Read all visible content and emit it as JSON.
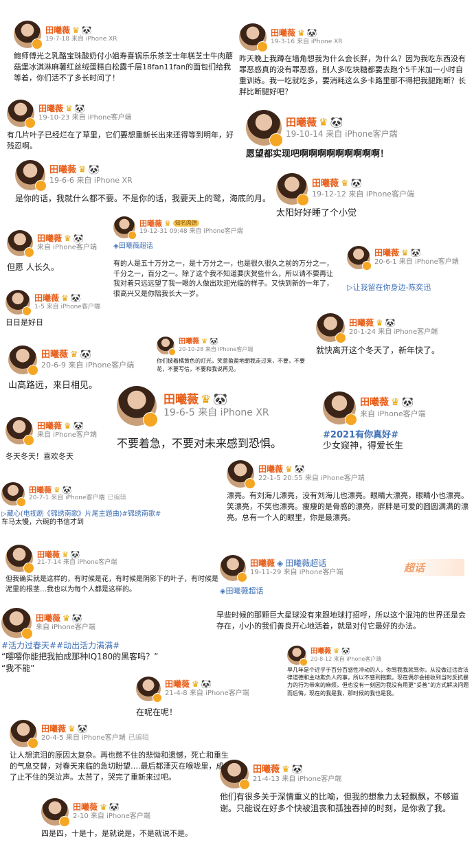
{
  "user_name": "田曦薇",
  "icons": {
    "crown": "♛",
    "panda": "🐼",
    "diamond": "◈",
    "play": "▷"
  },
  "posts": [
    {
      "time": "19-7-18",
      "source": "来自 iPhone XR",
      "text": "鲍师傅光之乳酪宝珠酸奶付小姐寿喜锅乐乐茶芝士年糕芝士牛肉蘑菇堡冰淇淋麻薯红丝绒蛋糕白松露千层18fan11fan的面包们给我等着，你们活不了多长时间了！"
    },
    {
      "time": "19-3-16",
      "source": "来自 iPhone XR",
      "text": "昨天晚上我蹲在墙角想我为什么会长胖，为什么？因为我吃东西没有罪恶感真的没有罪恶感，别人多吃块糖都要去跑个5千米加一小时自重训练。我一吃就吃多，要消耗这么多卡路里那不得把我腿跑断？长胖比断腿好吧？"
    },
    {
      "time": "19-10-23",
      "source": "来自 iPhone客户端",
      "text": "有几片叶子已经烂在了草里，它们要想重新长出来还得等到明年，好残忍啊。"
    },
    {
      "time": "19-10-14",
      "source": "来自 iPhone客户端",
      "text": "愿望都实现吧啊啊啊啊啊啊啊啊啊！"
    },
    {
      "time": "19-6-6",
      "source": "来自 iPhone XR",
      "text": "是你的话，我就什么都不要。不是你的话，我要天上的鹭，海底的月。"
    },
    {
      "time": "19-12-12",
      "source": "来自 iPhone客户端",
      "text": "太阳好好睡了个小觉"
    },
    {
      "time": "19-12-31 09:48",
      "source": "来自 iPhone客户端",
      "badge": "知名肉饼",
      "topic": "田曦薇超话",
      "text": "有的人是五十万分之一，是十万分之一，也是很久很久之前的万分之一，千分之一，百分之一。除了这个我不知道要庆贺些什么，所以请不要再让我对着只远远望了我一眼的人做出欢迎光临的样子。又快到新的一年了，很高兴又是你陪我长大一岁。"
    },
    {
      "time": "",
      "source": "来自 iPhone客户端",
      "text": "但愿 人长久。"
    },
    {
      "time": "20-6-1",
      "source": "来自 iPhone客户端",
      "link": "让我留在你身边-陈奕迅"
    },
    {
      "time": "1-5",
      "source": "来自 iPhone客户端",
      "text": "日日是好日"
    },
    {
      "time": "20-1-24",
      "source": "来自 iPhone客户端",
      "text": "就快离开这个冬天了，新年快了。"
    },
    {
      "time": "20-10-28",
      "source": "来自 iPhone客户端",
      "text": "你们披着橘黄色的灯光，笑意盈盈地朝我走过来，不要，不要花，不要写信，不要和我说再见。"
    },
    {
      "time": "20-6-9",
      "source": "来自 iPhone客户端",
      "text": "山高路远，来日相见。"
    },
    {
      "time": "19-6-5",
      "source": "来自 iPhone XR",
      "text": "不要着急，不要对未来感到恐惧。"
    },
    {
      "time": "",
      "source": "来自 iPhone客户端",
      "text": "冬天冬天！喜欢冬天"
    },
    {
      "time": "",
      "source": "来自 iPhone客户端",
      "topic": "#2021有你真好#",
      "text": "少女窥神，得爱长生"
    },
    {
      "time": "20-7-1",
      "source": "来自 iPhone客户端",
      "edited": "已编辑",
      "link": "藏心(电视剧《锦绣南歌》片尾主题曲)",
      "topic": "#锦绣南歌#",
      "text": "车马太慢，六碗的书信才到"
    },
    {
      "time": "22-1-5 20:55",
      "source": "来自 iPhone客户端",
      "text": "漂亮。有刘海儿漂亮，没有刘海儿也漂亮。眼睛大漂亮，眼睛小也漂亮。笑漂亮，不笑也漂亮。瘦瘦的是骨感的漂亮，胖胖是可爱的圆圆满满的漂亮。总有一个人的眼里，你是最漂亮。"
    },
    {
      "time": "21-7-14",
      "source": "来自 iPhone客户端",
      "text": "但我确实就是这样的，有时候是花，有时候是阴影下的叶子，有时候是泥里的根茎…我也以为每个人都是这样的。"
    },
    {
      "time": "19-11-29",
      "source": "来自 iPhone客户端",
      "topic": "田曦薇超话",
      "topic2": "田曦薇超话",
      "chaohua": "超话"
    },
    {
      "time": "",
      "source": "来自 iPhone客户端",
      "tags": [
        "#活力过春天#",
        "#动出活力满满#"
      ],
      "text": "“嘤嘤你能把我拍成那种IQ180的黑客吗？”",
      "text2": "“我不能”"
    },
    {
      "time": "",
      "source": "",
      "text": "早些时候的那颗巨大星球没有来跟地球打招呼，所以这个混沌的世界还是会存在，小小的我们善良开心地活着，就是对付它最好的办法。"
    },
    {
      "time": "20-8-12",
      "source": "来自 iPhone客户端",
      "text": "早几年是个近乎于百分百感性冲动的人，你骂我我就骂你，从没做过违背法律道德和主动欺负人的事，所以不感到抱歉。现在偶尔会接收到当时反抗暴力的行为带来的麻烦，但也没有一刻因为我没有用更“妥善”的方式解决问题而后悔，现在的我是我，那时候的我也是我。"
    },
    {
      "time": "21-4-8",
      "source": "来自 iPhone客户端",
      "text": "在呢在呢！"
    },
    {
      "time": "20-4-5",
      "source": "来自 iPhone客户端",
      "edited": "已编辑",
      "text": "让人想流泪的原因太复杂。再也憋不住的悲恸和遗憾，死亡和重生的气息交替，对春天来临的急切盼望….最后都湮灭在喉咙里，成了止不住的哭泣声。太苦了，哭完了重新来过吧。"
    },
    {
      "time": "21-4-13",
      "source": "来自 iPhone客户端",
      "text": "他们有很多关于深情重义的比喻，但我的想象力太轻飘飘，不够道谢。只能说在好多个快被沮丧和孤独吞掉的时刻，是你救了我。"
    },
    {
      "time": "2-10",
      "source": "来自 iPhone客户端",
      "text": "四是四，十是十，是就说是，不是就说不是。"
    }
  ]
}
